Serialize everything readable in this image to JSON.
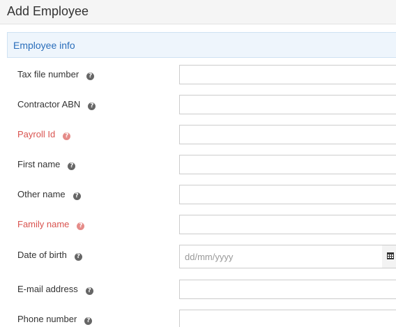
{
  "header": {
    "title": "Add Employee"
  },
  "section": {
    "title": "Employee info"
  },
  "fields": {
    "tax_file_number": {
      "label": "Tax file number",
      "value": ""
    },
    "contractor_abn": {
      "label": "Contractor ABN",
      "value": ""
    },
    "payroll_id": {
      "label": "Payroll Id",
      "value": "",
      "required": true
    },
    "first_name": {
      "label": "First name",
      "value": ""
    },
    "other_name": {
      "label": "Other name",
      "value": ""
    },
    "family_name": {
      "label": "Family name",
      "value": "",
      "required": true
    },
    "date_of_birth": {
      "label": "Date of birth",
      "value": "",
      "placeholder": "dd/mm/yyyy"
    },
    "email_address": {
      "label": "E-mail address",
      "value": ""
    },
    "phone_number": {
      "label": "Phone number",
      "value": ""
    }
  },
  "icons": {
    "help": "question-circle-icon",
    "calendar": "calendar-icon"
  },
  "colors": {
    "required_label": "#d9534f",
    "section_title": "#2a6ebb",
    "section_bg": "#eef5fc"
  }
}
